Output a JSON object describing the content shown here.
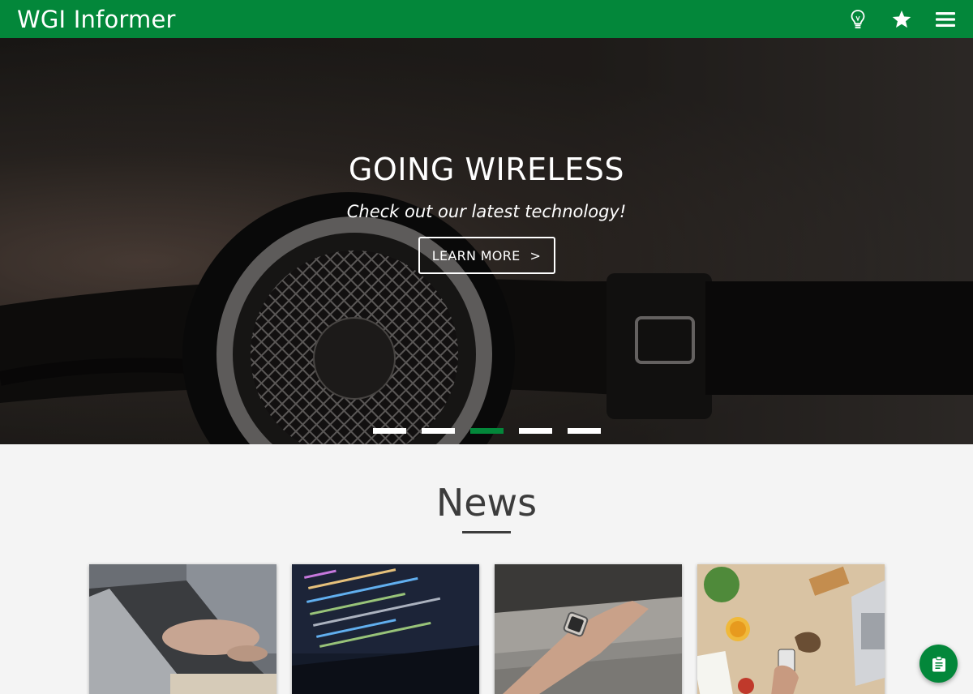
{
  "header": {
    "brand": "WGI Informer",
    "icons": [
      "lightbulb-icon",
      "star-icon",
      "menu-icon"
    ],
    "color": "#03873a"
  },
  "hero": {
    "title": "GOING WIRELESS",
    "subtitle": "Check out our latest technology!",
    "button_label": "LEARN MORE",
    "button_arrow": ">",
    "slides": 5,
    "active_slide": 3
  },
  "news": {
    "title": "News",
    "cards": [
      {
        "image": "laptop-typing-photo"
      },
      {
        "image": "code-screen-photo"
      },
      {
        "image": "smartwatch-wrist-photo"
      },
      {
        "image": "desk-flatlay-photo"
      }
    ]
  },
  "fab": {
    "icon": "clipboard-icon"
  }
}
